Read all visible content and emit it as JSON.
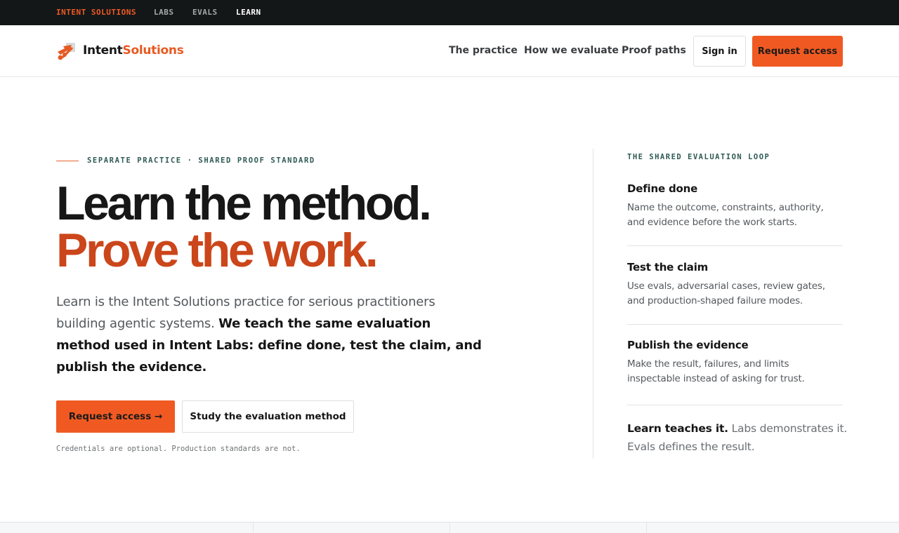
{
  "topbar": {
    "links": [
      {
        "label": "INTENT SOLUTIONS"
      },
      {
        "label": "LABS"
      },
      {
        "label": "EVALS"
      },
      {
        "label": "LEARN"
      }
    ]
  },
  "header": {
    "logo_icon": "arrow-mark-icon",
    "logo_text_a": "Intent",
    "logo_text_b": "Solutions",
    "nav": [
      {
        "label": "The practice"
      },
      {
        "label": "How we evaluate"
      },
      {
        "label": "Proof paths"
      }
    ],
    "signin_label": "Sign in",
    "request_label": "Request access"
  },
  "hero": {
    "eyebrow": "SEPARATE PRACTICE · SHARED PROOF STANDARD",
    "title_line1": "Learn the method.",
    "title_line2": "Prove the work.",
    "lead_plain": "Learn is the Intent Solutions practice for serious practitioners building agentic systems.",
    "lead_strong": "We teach the same evaluation method used in Intent Labs: define done, test the claim, and publish the evidence.",
    "cta_primary": "Request access →",
    "cta_secondary": "Study the evaluation method",
    "note": "Credentials are optional. Production standards are not."
  },
  "panel": {
    "title": "THE SHARED EVALUATION LOOP",
    "steps": [
      {
        "title": "Define done",
        "desc": "Name the outcome, constraints, authority, and evidence before the work starts."
      },
      {
        "title": "Test the claim",
        "desc": "Use evals, adversarial cases, review gates, and production-shaped failure modes."
      },
      {
        "title": "Publish the evidence",
        "desc": "Make the result, failures, and limits inspectable instead of asking for trust."
      }
    ],
    "closing_strong": "Learn teaches it.",
    "closing_rest": "Labs demonstrates it. Evals defines the result."
  },
  "colors": {
    "accent": "#f05a22",
    "accent_dark": "#cb461a",
    "teal": "#2f5a53",
    "topbar_bg": "#141718"
  }
}
